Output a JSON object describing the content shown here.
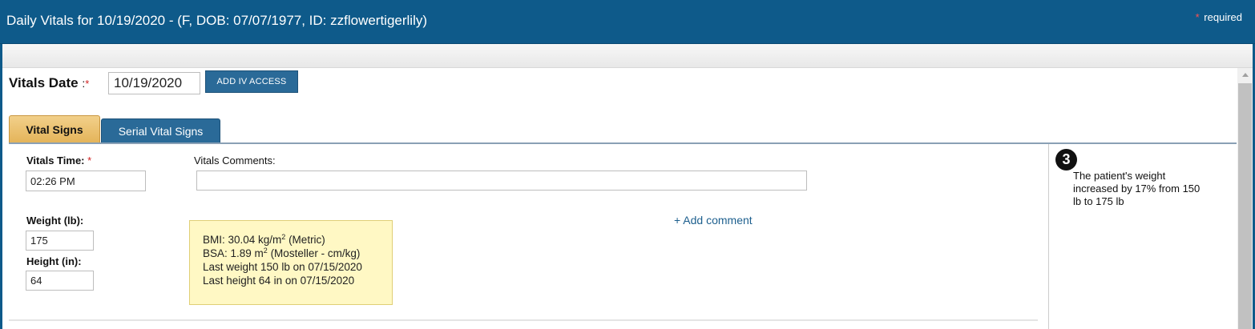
{
  "window": {
    "title": "Daily Vitals for 10/19/2020 - (F, DOB: 07/07/1977, ID: zzflowertigerlily)",
    "required_marker": "*",
    "required_label": "required"
  },
  "vitals_date": {
    "label": "Vitals Date",
    "colon": ":",
    "required_marker": "*",
    "value": "10/19/2020"
  },
  "buttons": {
    "add_iv_access": "ADD IV ACCESS",
    "add_comment": "+ Add comment"
  },
  "tabs": [
    {
      "label": "Vital Signs",
      "active": true
    },
    {
      "label": "Serial Vital Signs",
      "active": false
    }
  ],
  "form": {
    "vitals_time": {
      "label": "Vitals Time:",
      "required_marker": "*",
      "value": "02:26 PM"
    },
    "vitals_comments": {
      "label": "Vitals Comments:",
      "value": ""
    },
    "weight": {
      "label": "Weight (lb):",
      "value": "175"
    },
    "height": {
      "label": "Height (in):",
      "value": "64"
    }
  },
  "bmi_info": {
    "bmi_prefix": "BMI: 30.04 kg/m",
    "bmi_exp": "2",
    "bmi_suffix": " (Metric)",
    "bsa_prefix": "BSA: 1.89 m",
    "bsa_exp": "2",
    "bsa_suffix": " (Mosteller - cm/kg)",
    "last_weight": "Last weight 150 lb on 07/15/2020",
    "last_height": "Last height 64 in on 07/15/2020"
  },
  "callout": {
    "number": "3",
    "text": "The patient's weight increased by 17% from 150 lb to 175 lb"
  },
  "colors": {
    "header_blue": "#0e5a8a",
    "active_tab_gold": "#e4b45a",
    "info_box_yellow": "#fff8c4",
    "required_red": "#d02020",
    "link_blue": "#1d5f8e"
  }
}
